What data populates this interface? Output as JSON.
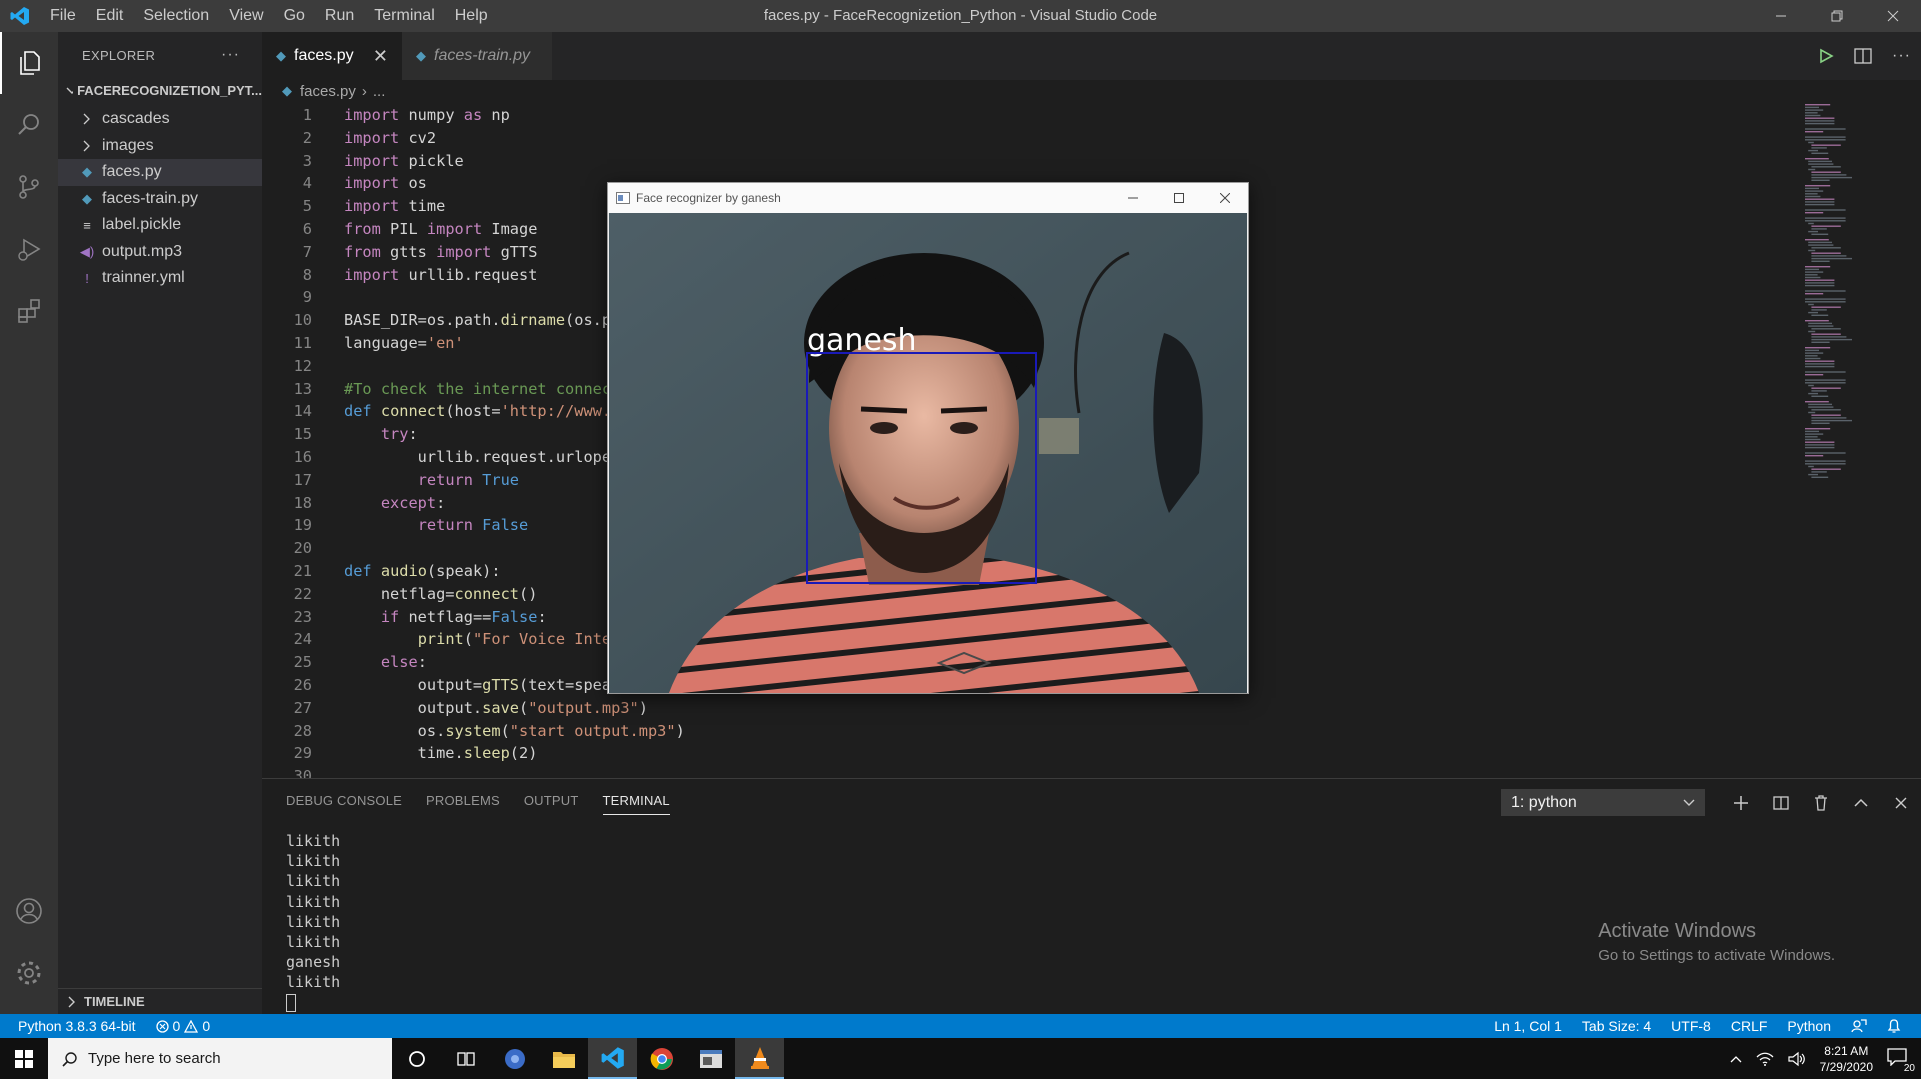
{
  "titlebar": {
    "window_title": "faces.py - FaceRecognizetion_Python - Visual Studio Code",
    "menu": [
      "File",
      "Edit",
      "Selection",
      "View",
      "Go",
      "Run",
      "Terminal",
      "Help"
    ]
  },
  "sidebar": {
    "header": "EXPLORER",
    "folder": "FACERECOGNIZETION_PYT...",
    "items": [
      {
        "label": "cascades",
        "icon": "chevron-right-icon"
      },
      {
        "label": "images",
        "icon": "chevron-right-icon"
      },
      {
        "label": "faces.py",
        "icon": "python-file-icon"
      },
      {
        "label": "faces-train.py",
        "icon": "python-file-icon"
      },
      {
        "label": "label.pickle",
        "icon": "file-icon"
      },
      {
        "label": "output.mp3",
        "icon": "audio-file-icon"
      },
      {
        "label": "trainner.yml",
        "icon": "yaml-file-icon"
      }
    ],
    "timeline": "TIMELINE"
  },
  "tabs": [
    {
      "label": "faces.py",
      "active": true
    },
    {
      "label": "faces-train.py",
      "active": false
    }
  ],
  "breadcrumb": {
    "file": "faces.py",
    "rest": "..."
  },
  "code_lines": [
    "import numpy as np",
    "import cv2",
    "import pickle",
    "import os",
    "import time",
    "from PIL import Image",
    "from gtts import gTTS",
    "import urllib.request",
    "",
    "BASE_DIR=os.path.dirname(os.p",
    "language='en'",
    "",
    "#To check the internet connec",
    "def connect(host='http://www.",
    "    try:",
    "        urllib.request.urlope",
    "        return True",
    "    except:",
    "        return False",
    "",
    "def audio(speak):",
    "    netflag=connect()",
    "    if netflag==False:",
    "        print(\"For Voice Inte",
    "    else:",
    "        output=gTTS(text=spea",
    "        output.save(\"output.mp3\")",
    "        os.system(\"start output.mp3\")",
    "        time.sleep(2)",
    ""
  ],
  "face_window": {
    "title": "Face recognizer by ganesh",
    "detected_name": "ganesh"
  },
  "panel": {
    "tabs": [
      "DEBUG CONSOLE",
      "PROBLEMS",
      "OUTPUT",
      "TERMINAL"
    ],
    "active_tab": "TERMINAL",
    "terminal_select": "1: python",
    "terminal_lines": [
      "likith",
      "likith",
      "likith",
      "likith",
      "likith",
      "likith",
      "ganesh",
      "likith"
    ]
  },
  "activate_windows": {
    "title": "Activate Windows",
    "subtitle": "Go to Settings to activate Windows."
  },
  "statusbar": {
    "interpreter": "Python 3.8.3 64-bit",
    "errors": "0",
    "warnings": "0",
    "position": "Ln 1, Col 1",
    "tab_size": "Tab Size: 4",
    "encoding": "UTF-8",
    "eol": "CRLF",
    "language": "Python"
  },
  "taskbar": {
    "search_placeholder": "Type here to search",
    "time": "8:21 AM",
    "date": "7/29/2020",
    "notifications": "20"
  },
  "colors": {
    "accent": "#007acc",
    "face_box": "#1a1ab8"
  }
}
